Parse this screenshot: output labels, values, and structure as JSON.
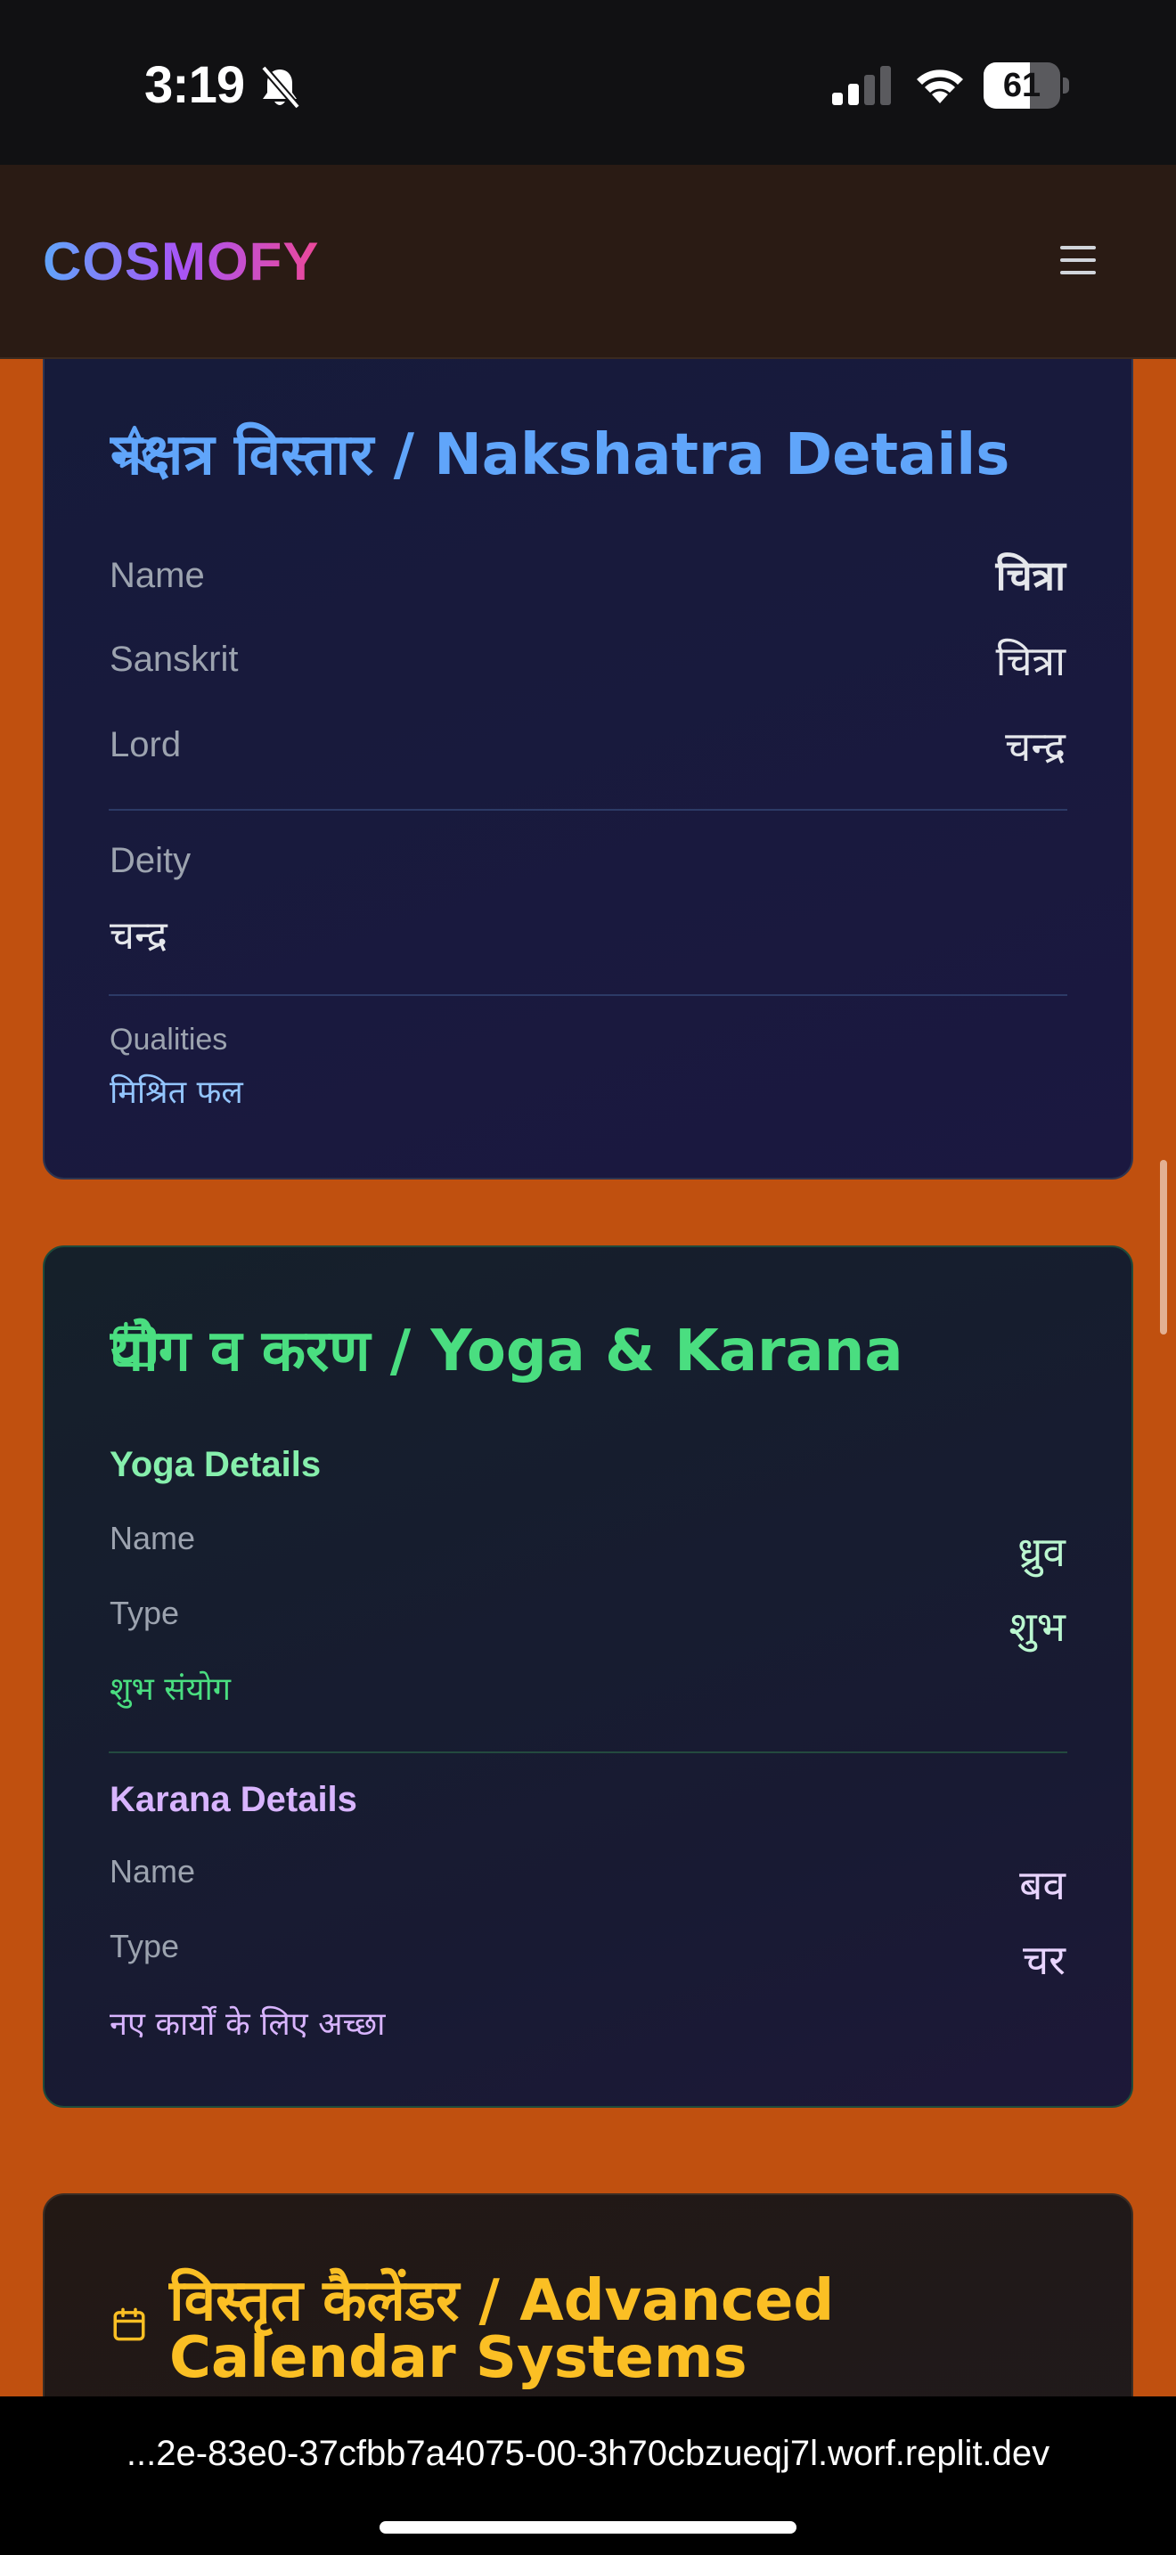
{
  "status_bar": {
    "time": "3:19",
    "battery_level": 61,
    "battery_text": "61",
    "icons": [
      "bell-slash-icon",
      "cellular-signal-icon",
      "wifi-icon",
      "battery-icon"
    ]
  },
  "header": {
    "brand": "COSMOFY",
    "menu_icon": "hamburger-menu-icon"
  },
  "nakshatra": {
    "title": "नक्षत्र विस्तार / Nakshatra Details",
    "icon": "star-icon",
    "color": "#60a5fa",
    "name_label": "Name",
    "name_value": "चित्रा",
    "sanskrit_label": "Sanskrit",
    "sanskrit_value": "चित्रा",
    "lord_label": "Lord",
    "lord_value": "चन्द्र",
    "deity_label": "Deity",
    "deity_value": "चन्द्र",
    "qualities_label": "Qualities",
    "qualities_value": "मिश्रित फल"
  },
  "yoga_karana": {
    "title": "योग व करण / Yoga & Karana",
    "icon": "calendar-icon",
    "color": "#4ade80",
    "yoga_heading": "Yoga Details",
    "yoga_name_label": "Name",
    "yoga_name_value": "ध्रुव",
    "yoga_type_label": "Type",
    "yoga_type_value": "शुभ",
    "yoga_note": "शुभ संयोग",
    "karana_heading": "Karana Details",
    "karana_color": "#d8b4fe",
    "karana_name_label": "Name",
    "karana_name_value": "बव",
    "karana_type_label": "Type",
    "karana_type_value": "चर",
    "karana_note": "नए कार्यों के लिए अच्छा"
  },
  "advanced_calendar": {
    "title_line1": "विस्तृत कैलेंडर / Advanced",
    "title_line2": "Calendar Systems",
    "icon": "calendar-icon",
    "color": "#fbbf24"
  },
  "browser": {
    "url": "...2e-83e0-37cfbb7a4075-00-3h70cbzueqj7l.worf.replit.dev"
  }
}
